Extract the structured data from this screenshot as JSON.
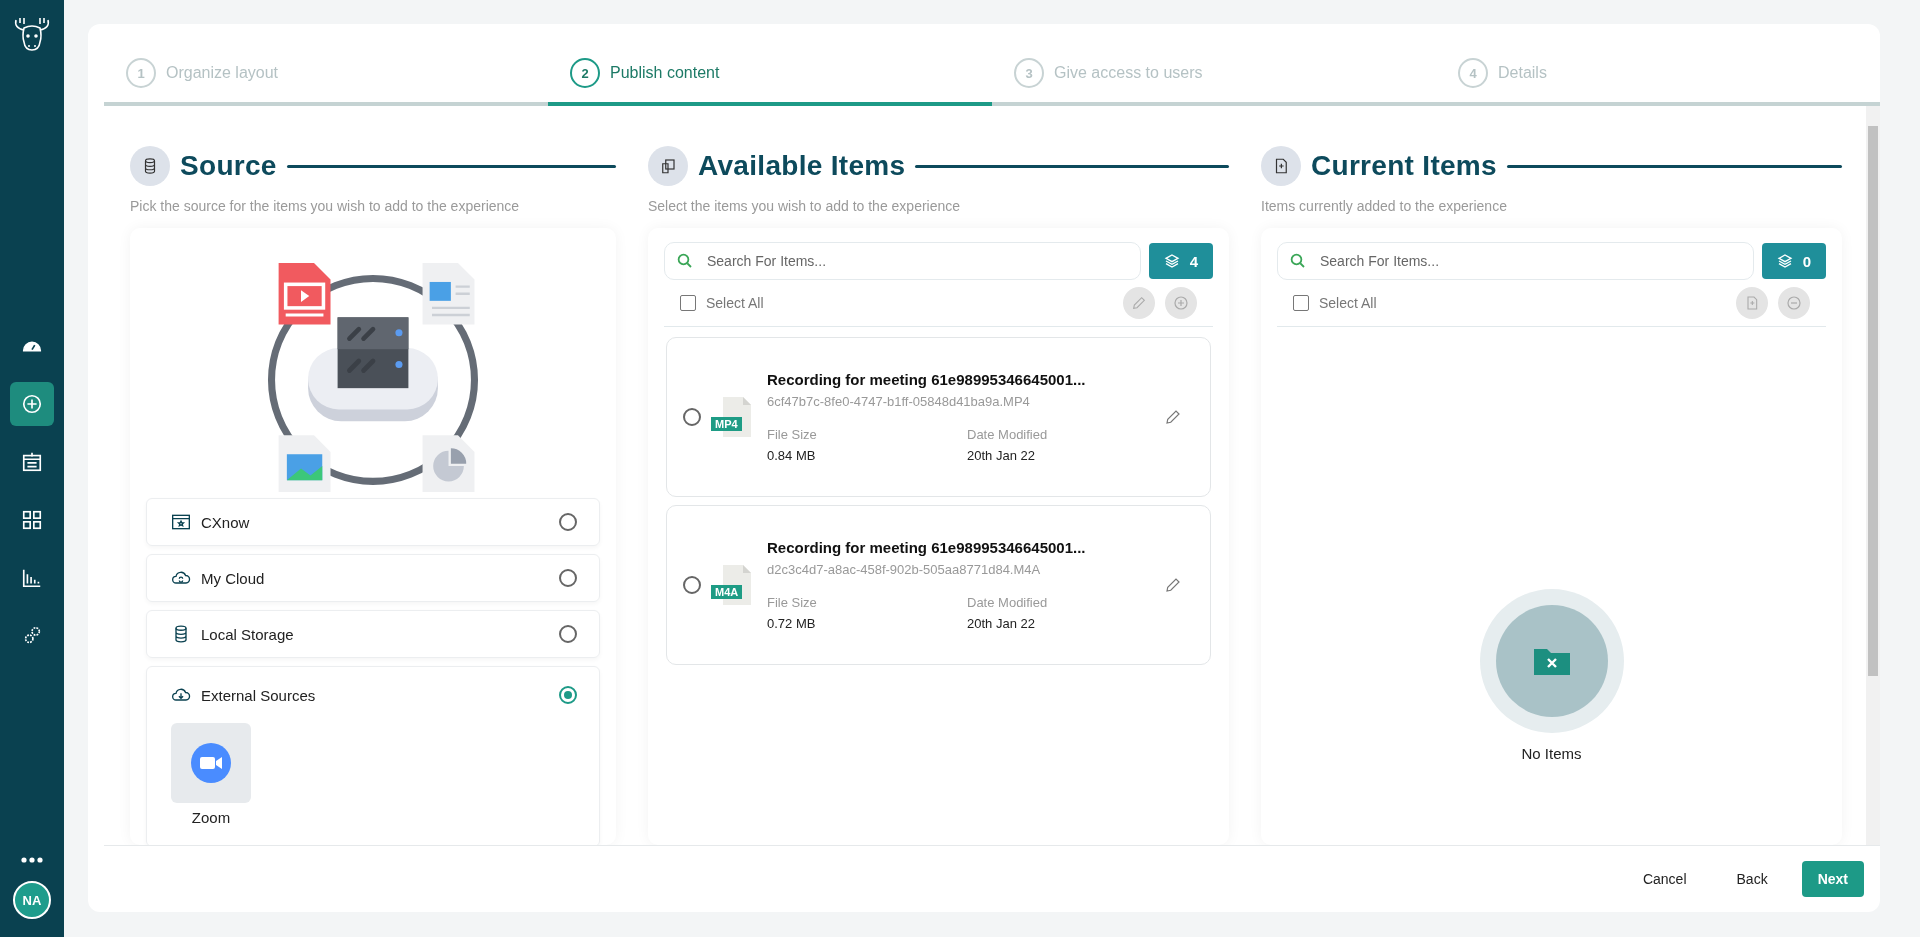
{
  "sidebar": {
    "nav": [
      {
        "kind": "gauge",
        "selected": false
      },
      {
        "kind": "add",
        "selected": true
      },
      {
        "kind": "calendar",
        "selected": false
      },
      {
        "kind": "grid",
        "selected": false
      },
      {
        "kind": "chart",
        "selected": false
      },
      {
        "kind": "gears",
        "selected": false
      }
    ],
    "avatar": "NA"
  },
  "steps": [
    {
      "number": "1",
      "label": "Organize layout",
      "selected": false
    },
    {
      "number": "2",
      "label": "Publish content",
      "selected": true
    },
    {
      "number": "3",
      "label": "Give access to users",
      "selected": false
    },
    {
      "number": "4",
      "label": "Details",
      "selected": false
    }
  ],
  "source": {
    "title": "Source",
    "subtitle": "Pick the source for the items you wish to add to the experience",
    "options": [
      {
        "kind": "app",
        "label": "CXnow",
        "selected": false
      },
      {
        "kind": "cloud",
        "label": "My Cloud",
        "selected": false
      },
      {
        "kind": "storage",
        "label": "Local Storage",
        "selected": false
      },
      {
        "kind": "external",
        "label": "External Sources",
        "selected": true,
        "providers": [
          {
            "label": "Zoom"
          }
        ]
      }
    ]
  },
  "available": {
    "title": "Available Items",
    "subtitle": "Select the items you wish to add to the experience",
    "search": {
      "placeholder": "Search For Items..."
    },
    "count": "4",
    "select_all": {
      "label": "Select All",
      "checked": false
    },
    "items": [
      {
        "title": "Recording for meeting 61e98995346645001...",
        "filename": "6cf47b7c-8fe0-4747-b1ff-05848d41ba9a.MP4",
        "file_type": "MP4",
        "size_label": "File Size",
        "size": "0.84 MB",
        "date_label": "Date Modified",
        "date": "20th Jan 22",
        "selected": false
      },
      {
        "title": "Recording for meeting 61e98995346645001...",
        "filename": "d2c3c4d7-a8ac-458f-902b-505aa8771d84.M4A",
        "file_type": "M4A",
        "size_label": "File Size",
        "size": "0.72 MB",
        "date_label": "Date Modified",
        "date": "20th Jan 22",
        "selected": false
      }
    ]
  },
  "current": {
    "title": "Current Items",
    "subtitle": "Items currently added to the experience",
    "search": {
      "placeholder": "Search For Items..."
    },
    "count": "0",
    "select_all": {
      "label": "Select All",
      "checked": false
    },
    "empty_text": "No Items"
  },
  "footer": {
    "buttons": [
      {
        "kind": "text",
        "label": "Cancel"
      },
      {
        "kind": "text",
        "label": "Back"
      },
      {
        "kind": "primary",
        "label": "Next"
      }
    ]
  }
}
